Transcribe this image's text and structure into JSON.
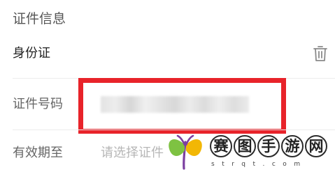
{
  "section": {
    "title": "证件信息"
  },
  "id_type": {
    "label": "身份证",
    "delete_icon": "trash-icon"
  },
  "id_number": {
    "label": "证件号码",
    "value_state": "blurred"
  },
  "validity": {
    "label": "有效期至",
    "placeholder": "请选择证件"
  },
  "highlight": {
    "color": "#e8232a"
  },
  "watermark": {
    "chars": [
      "赛",
      "图",
      "手",
      "游",
      "网"
    ],
    "domain": "strqt.com",
    "logo": "sprout-logo",
    "colors": {
      "green": "#7ec242",
      "yellow": "#f2b705",
      "purple": "#7b3fa0"
    }
  }
}
